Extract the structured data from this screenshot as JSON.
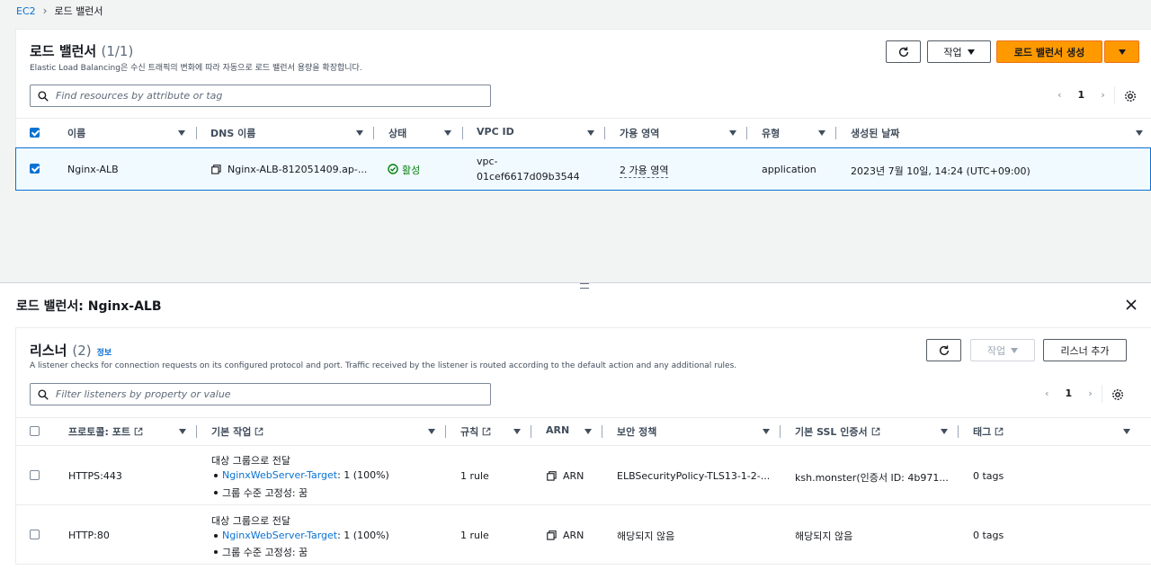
{
  "breadcrumb": {
    "root": "EC2",
    "current": "로드 밸런서"
  },
  "lb_list": {
    "title": "로드 밸런서",
    "count": "(1/1)",
    "description": "Elastic Load Balancing은 수신 트래픽의 변화에 따라 자동으로 로드 밸런서 용량을 확장합니다.",
    "refresh_icon": "refresh-icon",
    "actions_label": "작업",
    "create_label": "로드 밸런서 생성",
    "search_placeholder": "Find resources by attribute or tag",
    "page": "1",
    "columns": [
      "이름",
      "DNS 이름",
      "상태",
      "VPC ID",
      "가용 영역",
      "유형",
      "생성된 날짜"
    ],
    "rows": [
      {
        "name": "Nginx-ALB",
        "dns": "Nginx-ALB-812051409.ap-...",
        "state": "활성",
        "vpc_line1": "vpc-",
        "vpc_line2": "01cef6617d09b3544",
        "az": "2 가용 영역",
        "type": "application",
        "created": "2023년 7월 10일, 14:24 (UTC+09:00)"
      }
    ]
  },
  "detail": {
    "title_prefix": "로드 밸런서:",
    "title_name": "Nginx-ALB",
    "listeners": {
      "title": "리스너",
      "count": "(2)",
      "info": "정보",
      "description": "A listener checks for connection requests on its configured protocol and port. Traffic received by the listener is routed according to the default action and any additional rules.",
      "actions_label": "작업",
      "add_label": "리스너 추가",
      "search_placeholder": "Filter listeners by property or value",
      "page": "1",
      "columns": [
        "프로토콜: 포트",
        "기본 작업",
        "규칙",
        "ARN",
        "보안 정책",
        "기본 SSL 인증서",
        "태그"
      ],
      "rows": [
        {
          "protocol": "HTTPS:443",
          "action_title": "대상 그룹으로 전달",
          "target_link": "NginxWebServer-Target",
          "target_rest": ": 1 (100%)",
          "stickiness": "그룹 수준 고정성: 꿈",
          "rules": "1 rule",
          "arn": "ARN",
          "policy": "ELBSecurityPolicy-TLS13-1-2-...",
          "cert": "ksh.monster(인증서 ID: 4b971...",
          "tags": "0 tags"
        },
        {
          "protocol": "HTTP:80",
          "action_title": "대상 그룹으로 전달",
          "target_link": "NginxWebServer-Target",
          "target_rest": ": 1 (100%)",
          "stickiness": "그룹 수준 고정성: 꿈",
          "rules": "1 rule",
          "arn": "ARN",
          "policy": "해당되지 않음",
          "cert": "해당되지 않음",
          "tags": "0 tags"
        }
      ]
    }
  },
  "colors": {
    "accent": "#0972d3",
    "primary_button": "#ff9900",
    "success": "#037f0c"
  }
}
